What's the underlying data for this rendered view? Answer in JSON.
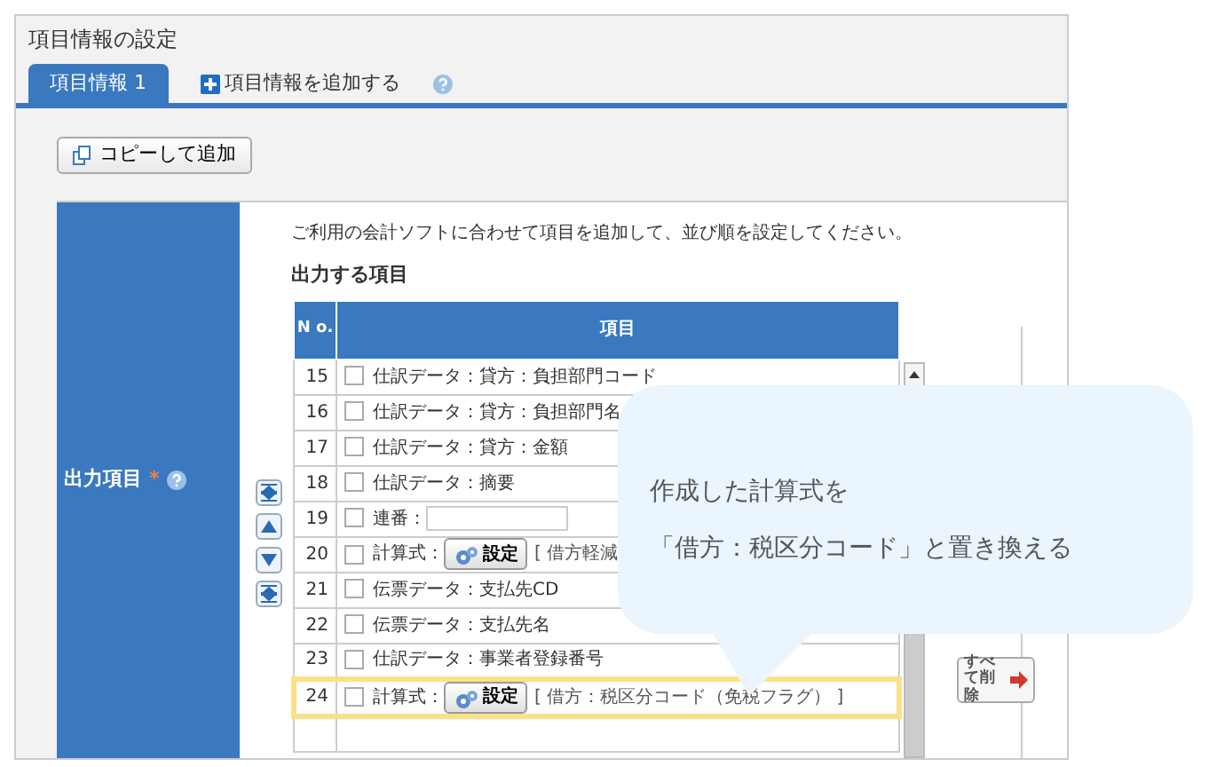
{
  "panel_title": "項目情報の設定",
  "tabs": [
    {
      "label": "項目情報 1",
      "selected": true,
      "kind": "tab"
    },
    {
      "label": "項目情報を追加する",
      "selected": false,
      "kind": "add"
    }
  ],
  "copy_button": "コピーして追加",
  "field_label": "出力項目",
  "required_mark": "*",
  "instruction": "ご利用の会計ソフトに合わせて項目を追加して、並び順を設定してください。",
  "section_title": "出力する項目",
  "table": {
    "columns": [
      "N o.",
      "項目"
    ],
    "rows": [
      {
        "no": "15",
        "checked": false,
        "kind": "text",
        "label": "仕訳データ：貸方：負担部門コード",
        "highlighted": false
      },
      {
        "no": "16",
        "checked": false,
        "kind": "text",
        "label": "仕訳データ：貸方：負担部門名",
        "highlighted": false
      },
      {
        "no": "17",
        "checked": false,
        "kind": "text",
        "label": "仕訳データ：貸方：金額",
        "highlighted": false
      },
      {
        "no": "18",
        "checked": false,
        "kind": "text",
        "label": "仕訳データ：摘要",
        "highlighted": false
      },
      {
        "no": "19",
        "checked": false,
        "kind": "input",
        "label": "連番：",
        "highlighted": false
      },
      {
        "no": "20",
        "checked": false,
        "kind": "formula",
        "label": "計算式：",
        "button": "設定",
        "value": "[ 借方軽減",
        "highlighted": false
      },
      {
        "no": "21",
        "checked": false,
        "kind": "text",
        "label": "伝票データ：支払先CD",
        "highlighted": false
      },
      {
        "no": "22",
        "checked": false,
        "kind": "text",
        "label": "伝票データ：支払先名",
        "highlighted": false
      },
      {
        "no": "23",
        "checked": false,
        "kind": "text",
        "label": "仕訳データ：事業者登録番号",
        "highlighted": false
      },
      {
        "no": "24",
        "checked": false,
        "kind": "formula",
        "label": "計算式：",
        "button": "設定",
        "value": "[ 借方：税区分コード（免税フラグ） ]",
        "highlighted": true
      }
    ]
  },
  "delete_all_button": "すべて削除",
  "callout": {
    "lines": [
      "作成した計算式を",
      "「借方：税区分コード」と置き換える"
    ]
  }
}
